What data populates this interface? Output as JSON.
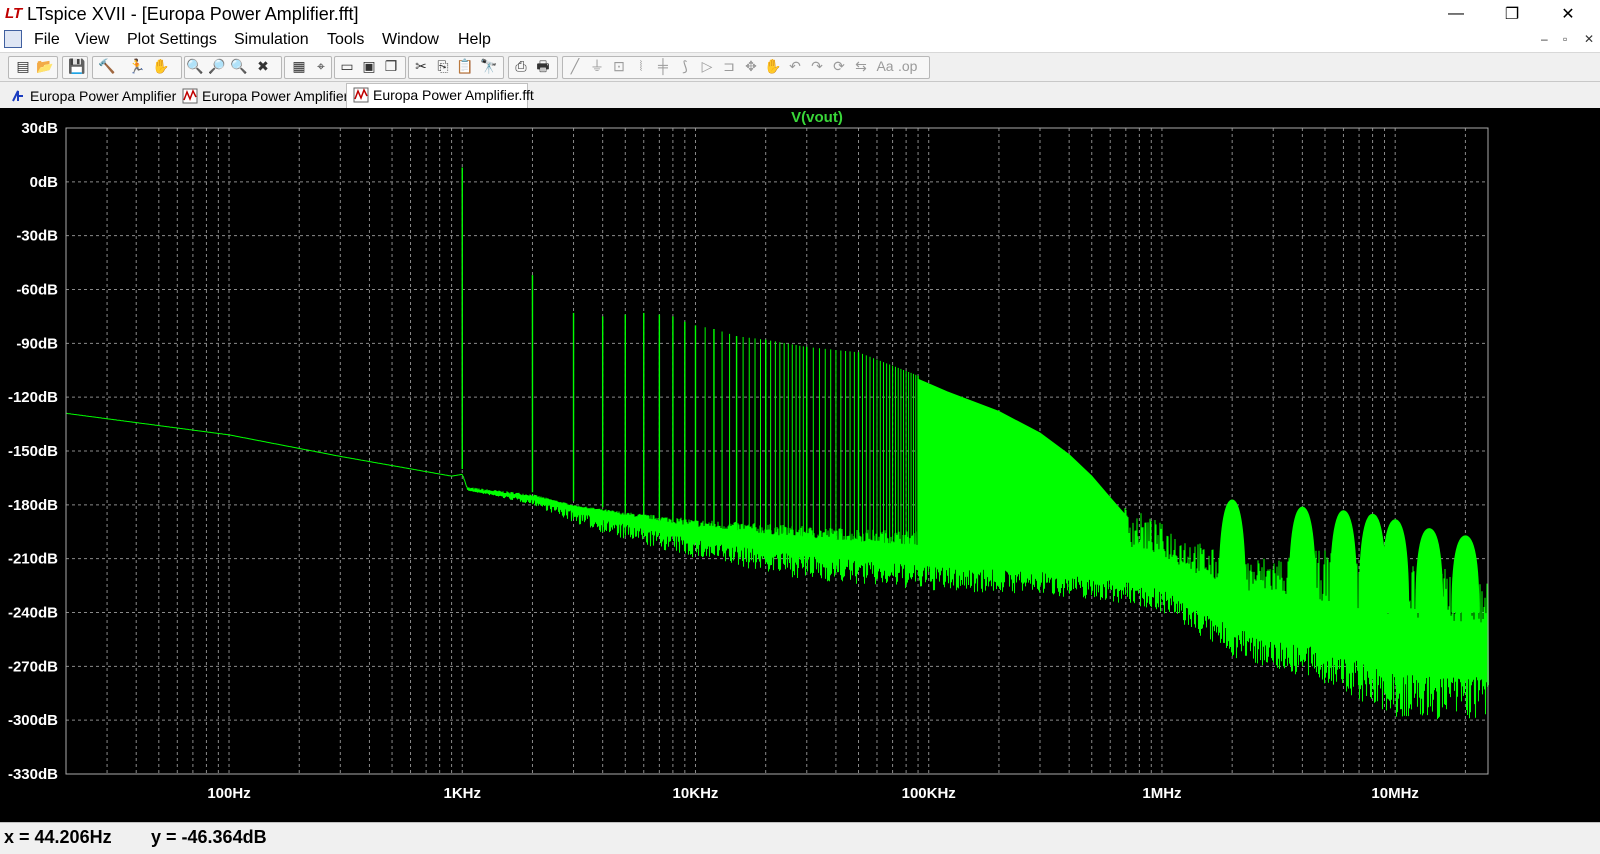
{
  "window": {
    "app_icon_text": "LT",
    "title": "LTspice XVII - [Europa Power Amplifier.fft]",
    "minimize": "—",
    "maximize": "❐",
    "close": "✕"
  },
  "menu": {
    "items": [
      "File",
      "View",
      "Plot Settings",
      "Simulation",
      "Tools",
      "Window",
      "Help"
    ],
    "mdi_minimize": "–",
    "mdi_restore": "▫",
    "mdi_close": "✕"
  },
  "tabs": [
    {
      "label": "Europa Power Amplifier",
      "icon": "schematic-icon",
      "active": false
    },
    {
      "label": "Europa Power Amplifier",
      "icon": "waveform-icon",
      "active": false
    },
    {
      "label": "Europa Power Amplifier.fft",
      "icon": "waveform-icon",
      "active": true
    }
  ],
  "toolbar": {
    "icons": [
      "new-schematic-icon",
      "open-icon",
      "save-icon",
      "control-panel-icon",
      "run-icon",
      "halt-icon",
      "zoom-in-icon",
      "zoom-area-icon",
      "zoom-out-icon",
      "zoom-cancel-icon",
      "autorange-icon",
      "cursor-icon",
      "tile-vertical-icon",
      "tile-horizontal-icon",
      "cascade-icon",
      "cut-icon",
      "copy-icon",
      "paste-icon",
      "find-icon",
      "print-setup-icon",
      "print-icon",
      "wire-icon",
      "ground-icon",
      "label-icon",
      "resistor-icon",
      "capacitor-icon",
      "inductor-icon",
      "diode-icon",
      "component-icon",
      "move-icon",
      "drag-icon",
      "undo-icon",
      "redo-icon",
      "rotate-icon",
      "mirror-icon",
      "text-icon",
      "spice-directive-icon"
    ]
  },
  "colors": {
    "plot_bg": "#000000",
    "trace": "#00ff00",
    "grid": "#8a8a8a",
    "axis_text": "#ffffff",
    "trace_label": "#39d639"
  },
  "chart_data": {
    "type": "line",
    "title": "V(vout)",
    "xlabel": "",
    "ylabel": "",
    "x_scale": "log",
    "xlim": [
      20,
      25000000
    ],
    "ylim": [
      -330,
      30
    ],
    "grid": true,
    "y_ticks": [
      "30dB",
      "0dB",
      "-30dB",
      "-60dB",
      "-90dB",
      "-120dB",
      "-150dB",
      "-180dB",
      "-210dB",
      "-240dB",
      "-270dB",
      "-300dB",
      "-330dB"
    ],
    "y_tick_values": [
      30,
      0,
      -30,
      -60,
      -90,
      -120,
      -150,
      -180,
      -210,
      -240,
      -270,
      -300,
      -330
    ],
    "x_ticks": [
      "100Hz",
      "1KHz",
      "10KHz",
      "100KHz",
      "1MHz",
      "10MHz"
    ],
    "x_tick_values": [
      100,
      1000,
      10000,
      100000,
      1000000,
      10000000
    ],
    "series": [
      {
        "name": "V(vout)",
        "noise_floor": {
          "x": [
            20,
            100,
            300,
            900,
            1000,
            1050,
            2000,
            3000,
            5000,
            10000,
            30000,
            100000,
            300000,
            700000,
            1000000,
            2000000,
            5000000,
            10000000,
            25000000
          ],
          "y": [
            -129,
            -141,
            -153,
            -164,
            -163,
            -172,
            -176,
            -181,
            -187,
            -195,
            -203,
            -208,
            -212,
            -218,
            -222,
            -241,
            -253,
            -263,
            -265
          ],
          "upper_y": [
            -129,
            -141,
            -153,
            -164,
            -163,
            -170,
            -174,
            -180,
            -184,
            -188,
            -192,
            -195,
            -192,
            -180,
            -190,
            -210,
            -205,
            -210,
            -220
          ],
          "lower_y": [
            -129,
            -141,
            -153,
            -164,
            -163,
            -172,
            -180,
            -190,
            -200,
            -210,
            -222,
            -228,
            -230,
            -235,
            -240,
            -265,
            -280,
            -300,
            -300
          ]
        },
        "harmonics": {
          "x": [
            1000,
            2000,
            3000,
            4000,
            5000,
            6000,
            7000,
            8000,
            9000,
            10000,
            12000,
            15000,
            20000,
            30000,
            50000,
            90000
          ],
          "y": [
            8,
            -52,
            -73,
            -75,
            -74,
            -73,
            -74,
            -75,
            -78,
            -80,
            -82,
            -86,
            -88,
            -92,
            -95,
            -108
          ]
        },
        "dense_band": {
          "x": [
            90000,
            120000,
            200000,
            300000,
            400000,
            500000,
            600000,
            700000
          ],
          "y_top": [
            -110,
            -117,
            -128,
            -140,
            -152,
            -164,
            -176,
            -186
          ]
        },
        "lobes": {
          "x": [
            2000000,
            4000000,
            6000000,
            8000000,
            10000000,
            14000000,
            20000000
          ],
          "y": [
            -177,
            -181,
            -183,
            -185,
            -188,
            -193,
            -197
          ]
        }
      }
    ]
  },
  "status": {
    "x_readout": "x = 44.206Hz",
    "y_readout": "y = -46.364dB"
  }
}
